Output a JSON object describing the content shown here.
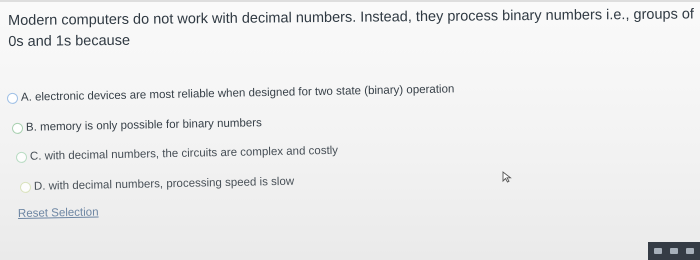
{
  "question": {
    "text": "Modern computers do not work with decimal numbers. Instead, they process binary numbers i.e., groups of 0s and 1s because"
  },
  "options": [
    {
      "label": "A. electronic devices are most reliable when designed for two state (binary) operation",
      "selected": false
    },
    {
      "label": "B. memory is only possible for binary numbers",
      "selected": false
    },
    {
      "label": "C. with decimal numbers, the circuits are complex and costly",
      "selected": false
    },
    {
      "label": "D. with decimal numbers, processing speed is slow",
      "selected": false
    }
  ],
  "reset": {
    "label": "Reset Selection"
  },
  "icons": {
    "cursor": "mouse-pointer-icon",
    "taskbar": [
      "network-icon",
      "volume-icon",
      "battery-icon"
    ]
  },
  "colors": {
    "link": "#6d86a3",
    "text": "#2f3942",
    "radio_border": "#9fc0e6"
  }
}
